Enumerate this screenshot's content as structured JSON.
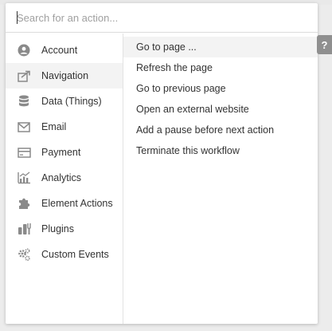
{
  "search": {
    "placeholder": "Search for an action...",
    "value": ""
  },
  "sidebar": {
    "items": [
      {
        "label": "Account",
        "icon": "account-icon"
      },
      {
        "label": "Navigation",
        "icon": "navigation-icon"
      },
      {
        "label": "Data (Things)",
        "icon": "database-icon"
      },
      {
        "label": "Email",
        "icon": "email-icon"
      },
      {
        "label": "Payment",
        "icon": "payment-card-icon"
      },
      {
        "label": "Analytics",
        "icon": "analytics-icon"
      },
      {
        "label": "Element Actions",
        "icon": "puzzle-icon"
      },
      {
        "label": "Plugins",
        "icon": "plugin-icon"
      },
      {
        "label": "Custom Events",
        "icon": "gears-icon"
      }
    ],
    "active": "Navigation"
  },
  "actions": {
    "items": [
      {
        "label": "Go to page ..."
      },
      {
        "label": "Refresh the page"
      },
      {
        "label": "Go to previous page"
      },
      {
        "label": "Open an external website"
      },
      {
        "label": "Add a pause before next action"
      },
      {
        "label": "Terminate this workflow"
      }
    ],
    "highlighted": "Go to page ..."
  },
  "help": {
    "label": "?"
  },
  "colors": {
    "panel_bg": "#ffffff",
    "highlight_bg": "#f3f3f3",
    "icon_gray": "#8a8a8a",
    "text": "#333333",
    "help_bg": "#8f8f8f"
  }
}
